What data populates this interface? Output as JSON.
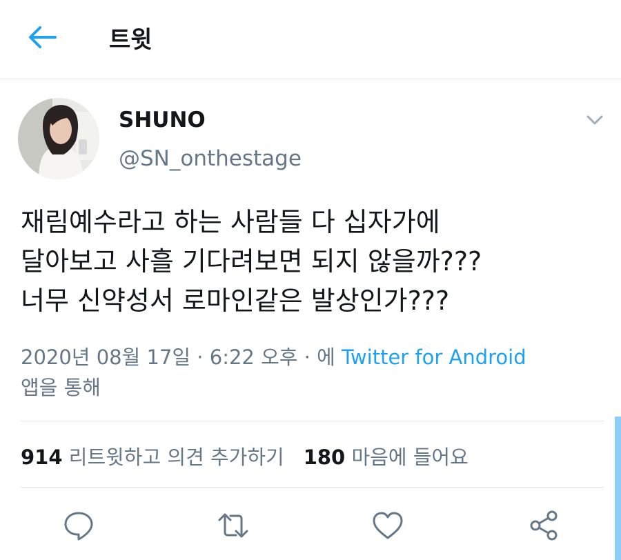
{
  "header": {
    "title": "트윗",
    "back_icon": "arrow-left-icon"
  },
  "author": {
    "display_name": "SHUNO",
    "username": "@SN_onthestage",
    "avatar": "avatar-photo"
  },
  "tweet": {
    "text": "재림예수라고 하는 사람들 다 십자가에\n달아보고 사흘 기다려보면 되지 않을까???\n너무 신약성서 로마인같은 발상인가???"
  },
  "meta": {
    "date": "2020년 08월 17일",
    "separator1": " · ",
    "time": "6:22 오후",
    "separator2": " · ",
    "via_prefix": "에 ",
    "source": "Twitter for Android",
    "suffix": "앱을 통해"
  },
  "stats": {
    "retweets_count": "914",
    "retweets_label": "리트윗하고 의견 추가하기",
    "likes_count": "180",
    "likes_label": "마음에 들어요"
  },
  "actions": [
    "reply-icon",
    "retweet-icon",
    "like-icon",
    "share-icon"
  ],
  "colors": {
    "accent": "#1da1f2",
    "secondary_text": "#657786",
    "divider": "#e1e8ed"
  }
}
